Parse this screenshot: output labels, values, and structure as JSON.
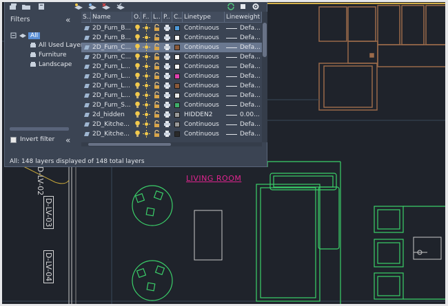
{
  "panel": {
    "filters_title": "Filters",
    "filter_tree": [
      {
        "label": "All",
        "selected": true
      },
      {
        "label": "All Used Layers"
      },
      {
        "label": "Furniture"
      },
      {
        "label": "Landscape"
      }
    ],
    "invert_filter_label": "Invert filter",
    "collapse_glyph": "«",
    "status_text": "All: 148 layers displayed of 148 total layers"
  },
  "toolbar_icons": [
    "new-property-filter-icon",
    "new-group-filter-icon",
    "layer-states-manager-icon",
    "new-layer-icon",
    "new-layer-vp-frozen-icon",
    "delete-layer-icon",
    "set-current-icon",
    "refresh-icon",
    "settings-icon"
  ],
  "table": {
    "columns": [
      "S..",
      "Name",
      "O..",
      "F..",
      "L..",
      "P..",
      "C..",
      "Linetype",
      "Lineweight"
    ],
    "rows": [
      {
        "name": "2D_Furn_B...",
        "color": "#4e9ad9",
        "linetype": "Continuous",
        "lineweight": "Defa..."
      },
      {
        "name": "2D_Furn_B...",
        "color": "#f2f2f2",
        "linetype": "Continuous",
        "lineweight": "Defa..."
      },
      {
        "name": "2D_Furn_C...",
        "color": "#8c5a3a",
        "linetype": "Continuous",
        "lineweight": "Defa...",
        "selected": true
      },
      {
        "name": "2D_Furn_C...",
        "color": "#f2f2f2",
        "linetype": "Continuous",
        "lineweight": "Defa..."
      },
      {
        "name": "2D_Furn_L...",
        "color": "#f2f2f2",
        "linetype": "Continuous",
        "lineweight": "Defa..."
      },
      {
        "name": "2D_Furn_L...",
        "color": "#e040b0",
        "linetype": "Continuous",
        "lineweight": "Defa..."
      },
      {
        "name": "2D_Furn_L...",
        "color": "#8c5a3a",
        "linetype": "Continuous",
        "lineweight": "Defa..."
      },
      {
        "name": "2D_Furn_L...",
        "color": "#e8e8e8",
        "linetype": "Continuous",
        "lineweight": "Defa..."
      },
      {
        "name": "2D_Furn_S...",
        "color": "#3fae6a",
        "linetype": "Continuous",
        "lineweight": "Defa..."
      },
      {
        "name": "2d_hidden",
        "color": "#9a9a9a",
        "linetype": "HIDDEN2",
        "lineweight": "0.00..."
      },
      {
        "name": "2D_Kitche...",
        "color": "#9a9a9a",
        "linetype": "Continuous",
        "lineweight": "Defa..."
      },
      {
        "name": "2D_Kitche...",
        "color": "#2a2a2a",
        "linetype": "Continuous",
        "lineweight": "Defa..."
      }
    ]
  },
  "drawing": {
    "room_label": "LIVING ROOM",
    "tags": [
      "D-LV-02",
      "D-LV-03",
      "D-LV-04"
    ]
  },
  "colors": {
    "background": "#1f232b",
    "panel_bg": "#3b4453",
    "selected_row": "#6a7890",
    "furniture_brown": "#9a6a4a",
    "furniture_green": "#3bd16a",
    "room_label": "#e0248f"
  }
}
